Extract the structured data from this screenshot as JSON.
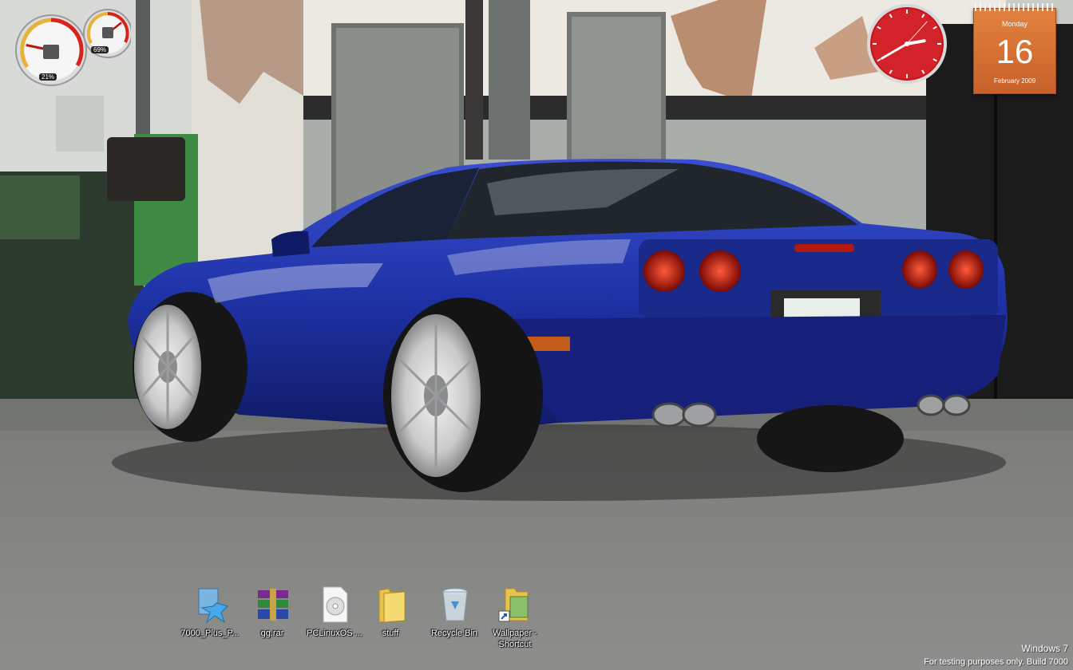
{
  "gadgets": {
    "cpu_meter": {
      "cpu_percent": "21%",
      "memory_percent": "69%",
      "cpu_value": 21,
      "memory_value": 69
    },
    "clock": {
      "hour": 2,
      "minute": 40,
      "second": 7
    },
    "calendar": {
      "weekday": "Monday",
      "date": "16",
      "month_year": "February 2009"
    }
  },
  "desktop_icons": [
    {
      "label": "7000_Plus_P...",
      "icon": "installer-icon"
    },
    {
      "label": "gg.rar",
      "icon": "winrar-archive-icon"
    },
    {
      "label": "PCLinuxOS ...",
      "icon": "disc-image-file-icon"
    },
    {
      "label": "stuff",
      "icon": "folder-icon"
    },
    {
      "label": "Recycle Bin",
      "icon": "recycle-bin-icon"
    },
    {
      "label": "Wallpaper - Shortcut",
      "icon": "folder-shortcut-icon"
    }
  ],
  "watermark": {
    "line1": "Windows  7",
    "line2": "For testing purposes only. Build 7000"
  },
  "colors": {
    "car_blue": "#1e2f9e",
    "calendar_orange": "#d8703a",
    "clock_red": "#c8141c"
  }
}
